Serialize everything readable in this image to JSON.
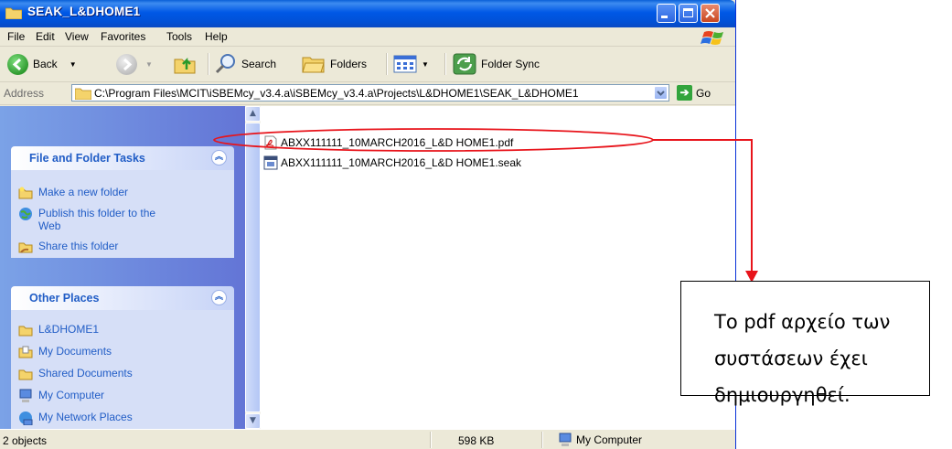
{
  "window": {
    "title": "SEAK_L&DHOME1",
    "title_icon": "folder-icon",
    "controls": [
      "minimize",
      "maximize",
      "close"
    ]
  },
  "menu": [
    "File",
    "Edit",
    "View",
    "Favorites",
    "Tools",
    "Help"
  ],
  "toolbar": {
    "back_label": "Back",
    "search_label": "Search",
    "folders_label": "Folders",
    "folder_sync_label": "Folder Sync"
  },
  "address": {
    "label": "Address",
    "value": "C:\\Program Files\\MCIT\\iSBEMcy_v3.4.a\\iSBEMcy_v3.4.a\\Projects\\L&DHOME1\\SEAK_L&DHOME1",
    "go_label": "Go"
  },
  "tasks_panel": {
    "title": "File and Folder Tasks",
    "items": [
      "Make a new folder",
      "Publish this folder to the Web",
      "Share this folder"
    ]
  },
  "places_panel": {
    "title": "Other Places",
    "items": [
      "L&DHOME1",
      "My Documents",
      "Shared Documents",
      "My Computer",
      "My Network Places"
    ]
  },
  "files": [
    {
      "name": "ABXX111111_10MARCH2016_L&D HOME1.pdf",
      "icon": "pdf-icon"
    },
    {
      "name": "ABXX111111_10MARCH2016_L&D HOME1.seak",
      "icon": "seak-file-icon"
    }
  ],
  "status": {
    "objects": "2 objects",
    "size": "598 KB",
    "location": "My Computer"
  },
  "annotation": {
    "text": "Το pdf αρχείο των συστάσεων έχει δημιουργηθεί.",
    "color": "#e8141b"
  }
}
